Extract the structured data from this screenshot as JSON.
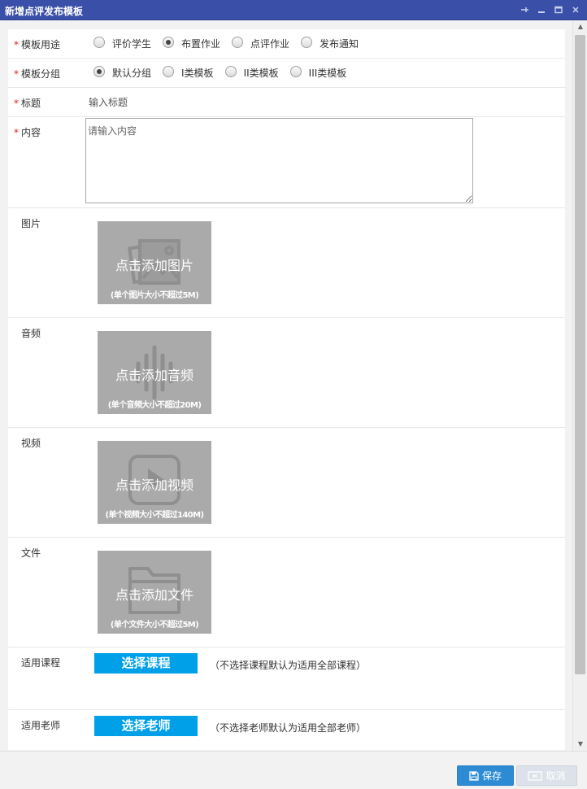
{
  "window": {
    "title": "新增点评发布模板",
    "controls": [
      "pin-icon",
      "minimize-icon",
      "maximize-icon",
      "close-icon"
    ]
  },
  "form": {
    "usage": {
      "label": "模板用途",
      "options": [
        {
          "label": "评价学生",
          "checked": false
        },
        {
          "label": "布置作业",
          "checked": true
        },
        {
          "label": "点评作业",
          "checked": false
        },
        {
          "label": "发布通知",
          "checked": false
        }
      ]
    },
    "group": {
      "label": "模板分组",
      "options": [
        {
          "label": "默认分组",
          "checked": true
        },
        {
          "label": "I类模板",
          "checked": false
        },
        {
          "label": "II类模板",
          "checked": false
        },
        {
          "label": "III类模板",
          "checked": false
        }
      ]
    },
    "title": {
      "label": "标题",
      "placeholder": "输入标题"
    },
    "content": {
      "label": "内容",
      "placeholder": "请输入内容"
    },
    "image": {
      "label": "图片",
      "main": "点击添加图片",
      "sub": "(单个图片大小不超过5M)"
    },
    "audio": {
      "label": "音频",
      "main": "点击添加音频",
      "sub": "(单个音频大小不超过20M)"
    },
    "video": {
      "label": "视频",
      "main": "点击添加视频",
      "sub": "(单个视频大小不超过140M)"
    },
    "file": {
      "label": "文件",
      "main": "点击添加文件",
      "sub": "(单个文件大小不超过5M)"
    },
    "course": {
      "label": "适用课程",
      "button": "选择课程",
      "hint": "（不选择课程默认为适用全部课程）"
    },
    "teacher": {
      "label": "适用老师",
      "button": "选择老师",
      "hint": "（不选择老师默认为适用全部老师）"
    }
  },
  "footer": {
    "save_label": "保存",
    "cancel_label": "取消"
  },
  "colors": {
    "titlebar": "#3a4fa8",
    "accent": "#00a0e9",
    "save": "#2d8bd4",
    "required": "#e02020"
  }
}
